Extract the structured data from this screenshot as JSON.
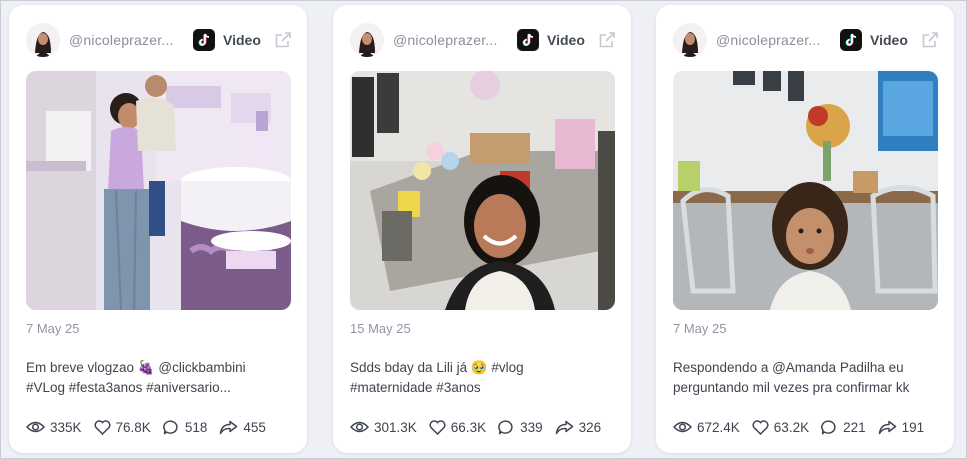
{
  "cards": [
    {
      "handle": "@nicoleprazer...",
      "type": "Video",
      "date": "7 May 25",
      "caption": "Em breve vlogzao 🍇 @clickbambini\n#VLog #festa3anos #aniversario...",
      "views": "335K",
      "likes": "76.8K",
      "comments": "518",
      "shares": "455"
    },
    {
      "handle": "@nicoleprazer...",
      "type": "Video",
      "date": "15 May 25",
      "caption": "Sdds bday da Lili já 🥹 #vlog\n#maternidade #3anos",
      "views": "301.3K",
      "likes": "66.3K",
      "comments": "339",
      "shares": "326"
    },
    {
      "handle": "@nicoleprazer...",
      "type": "Video",
      "date": "7 May 25",
      "caption": "Respondendo a @Amanda Padilha eu\nperguntando mil vezes pra confirmar kk",
      "views": "672.4K",
      "likes": "63.2K",
      "comments": "221",
      "shares": "191"
    }
  ],
  "icons": {
    "platform": "tiktok-icon",
    "external": "external-link-icon",
    "views": "eye-icon",
    "likes": "heart-icon",
    "comments": "comment-icon",
    "shares": "share-icon"
  },
  "colors": {
    "background": "#eef0f5",
    "card": "#ffffff",
    "muted": "#8f95a3",
    "text": "#3f4450"
  }
}
